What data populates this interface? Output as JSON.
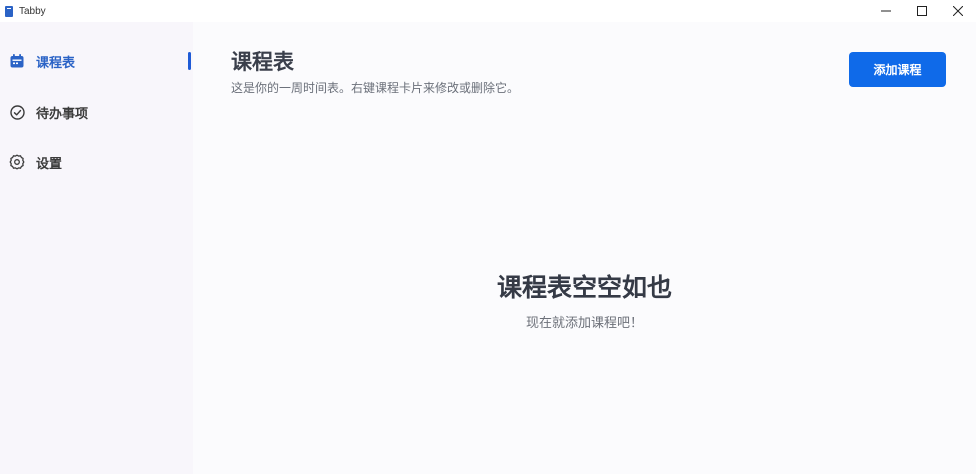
{
  "window": {
    "title": "Tabby",
    "controls": [
      "minimize-icon",
      "maximize-icon",
      "close-icon"
    ]
  },
  "sidebar": {
    "items": [
      {
        "label": "课程表",
        "icon": "calendar-icon",
        "active": true
      },
      {
        "label": "待办事项",
        "icon": "check-circle-icon",
        "active": false
      },
      {
        "label": "设置",
        "icon": "gear-icon",
        "active": false
      }
    ]
  },
  "main": {
    "title": "课程表",
    "subtitle": "这是你的一周时间表。右键课程卡片来修改或删除它。",
    "add_button_label": "添加课程",
    "empty_title": "课程表空空如也",
    "empty_subtitle": "现在就添加课程吧！"
  },
  "colors": {
    "accent": "#0f6ae9",
    "sidebar_bg": "#f8f6fb",
    "main_bg": "#fbfbfd"
  }
}
